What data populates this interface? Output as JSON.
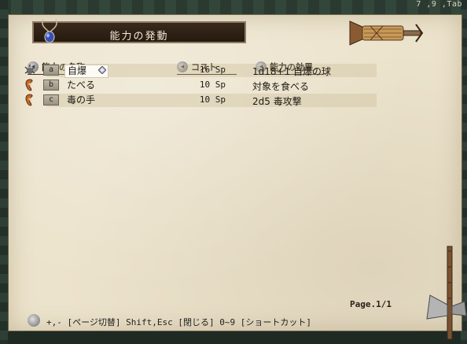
{
  "hud": {
    "tab_indicator": "7 ,9 ,Tab"
  },
  "dialog": {
    "title": "能力の発動",
    "columns": {
      "name": "能力の名称",
      "cost": "コスト",
      "effect": "能力の効果"
    },
    "abilities": [
      {
        "key": "a",
        "name": "自爆",
        "cost": "16 Sp",
        "effect": "1d18+1 自爆の球",
        "icon": "bomb-icon",
        "selected": true
      },
      {
        "key": "b",
        "name": "たべる",
        "cost": "10 Sp",
        "effect": "対象を食べる",
        "icon": "mouth-icon",
        "selected": false
      },
      {
        "key": "c",
        "name": "毒の手",
        "cost": "10 Sp",
        "effect": "2d5 毒攻撃",
        "icon": "mouth-icon",
        "selected": false
      }
    ],
    "page_indicator": "Page.1/1",
    "hint": "+,- [ページ切替]  Shift,Esc [閉じる]  0~9 [ショートカット]"
  },
  "colors": {
    "parchment": "#ece3cc",
    "title_plate": "#2e2016",
    "text": "#1d1a14"
  }
}
